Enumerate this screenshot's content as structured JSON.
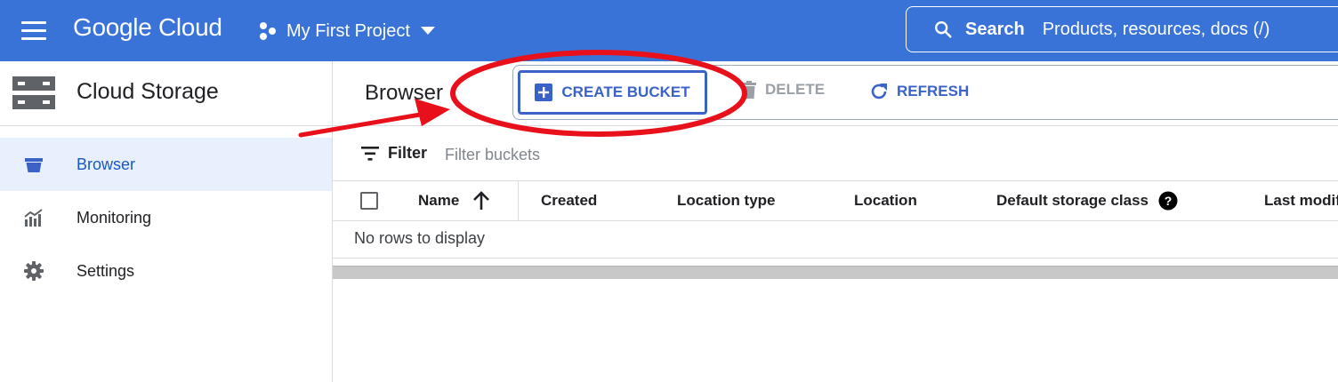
{
  "topbar": {
    "brand": "Google Cloud",
    "project_name": "My First Project",
    "search_label": "Search",
    "search_placeholder": "Products, resources, docs (/)",
    "background_color": "#3a73d8"
  },
  "sidebar": {
    "product_title": "Cloud Storage",
    "items": [
      {
        "label": "Browser",
        "icon": "bucket-icon",
        "active": true
      },
      {
        "label": "Monitoring",
        "icon": "chart-icon",
        "active": false
      },
      {
        "label": "Settings",
        "icon": "gear-icon",
        "active": false
      }
    ]
  },
  "main": {
    "title": "Browser",
    "actions": {
      "create": "CREATE BUCKET",
      "delete": "DELETE",
      "refresh": "REFRESH"
    },
    "filter": {
      "label": "Filter",
      "placeholder": "Filter buckets"
    },
    "table": {
      "columns": [
        "Name",
        "Created",
        "Location type",
        "Location",
        "Default storage class",
        "Last modif"
      ],
      "sort_column": "Name",
      "sort_direction": "ascending",
      "empty_message": "No rows to display"
    }
  },
  "colors": {
    "accent": "#3b63c7",
    "active_nav_bg": "#e8f0fe",
    "annotation": "#e8101a"
  }
}
